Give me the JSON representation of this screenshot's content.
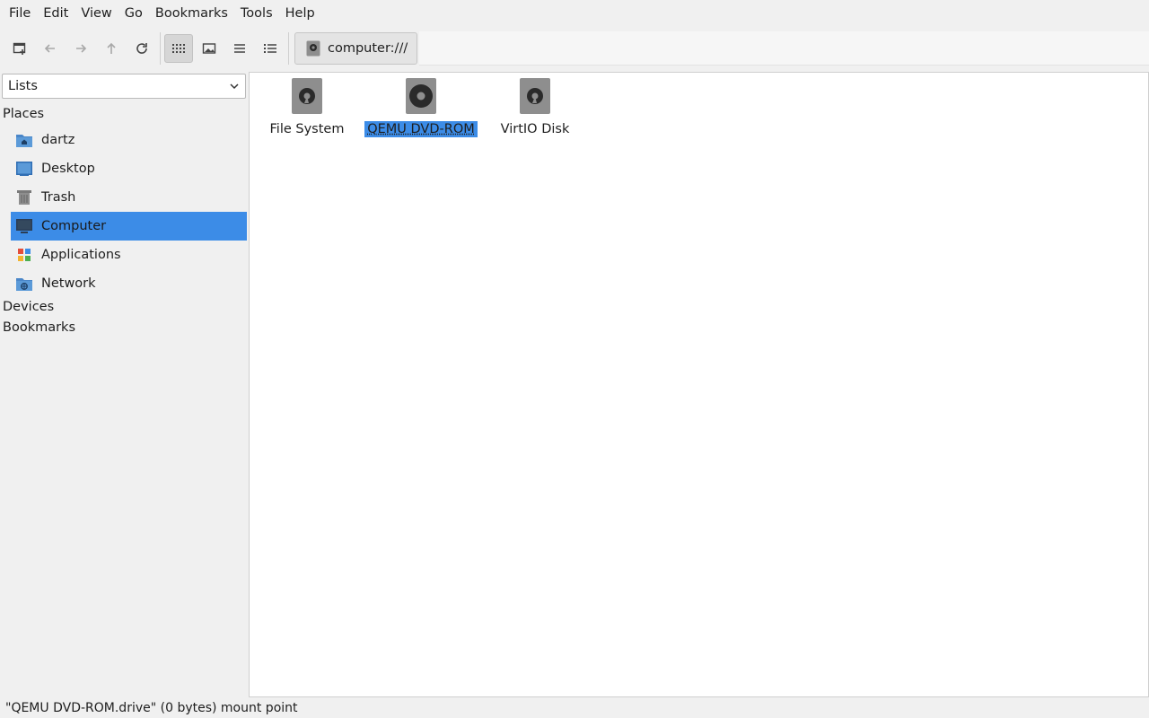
{
  "menu": [
    "File",
    "Edit",
    "View",
    "Go",
    "Bookmarks",
    "Tools",
    "Help"
  ],
  "toolbar": {
    "buttons": [
      {
        "name": "new-tab-icon",
        "enabled": true
      },
      {
        "name": "back-arrow-icon",
        "enabled": false
      },
      {
        "name": "forward-arrow-icon",
        "enabled": false
      },
      {
        "name": "up-arrow-icon",
        "enabled": false
      },
      {
        "name": "reload-icon",
        "enabled": true
      }
    ],
    "views": [
      {
        "name": "icon-view-icon",
        "active": true
      },
      {
        "name": "thumbnail-view-icon",
        "active": false
      },
      {
        "name": "compact-view-icon",
        "active": false
      },
      {
        "name": "detailed-list-view-icon",
        "active": false
      }
    ]
  },
  "location": {
    "path": "computer:///",
    "icon": "drive-icon"
  },
  "sidebar": {
    "selector": "Lists",
    "places_heading": "Places",
    "places": [
      {
        "label": "dartz",
        "icon": "home-folder-icon"
      },
      {
        "label": "Desktop",
        "icon": "desktop-icon"
      },
      {
        "label": "Trash",
        "icon": "trash-icon"
      },
      {
        "label": "Computer",
        "icon": "computer-icon",
        "selected": true
      },
      {
        "label": "Applications",
        "icon": "applications-icon"
      },
      {
        "label": "Network",
        "icon": "network-folder-icon"
      }
    ],
    "devices_heading": "Devices",
    "bookmarks_heading": "Bookmarks"
  },
  "items": [
    {
      "label": "File System",
      "icon": "harddisk-icon"
    },
    {
      "label": "QEMU DVD-ROM",
      "icon": "optical-drive-icon",
      "selected": true
    },
    {
      "label": "VirtIO Disk",
      "icon": "harddisk-icon"
    }
  ],
  "status": "\"QEMU DVD-ROM.drive\" (0 bytes) mount point",
  "colors": {
    "selection": "#3c8ce7",
    "icon_gray": "#8e8e8e"
  }
}
